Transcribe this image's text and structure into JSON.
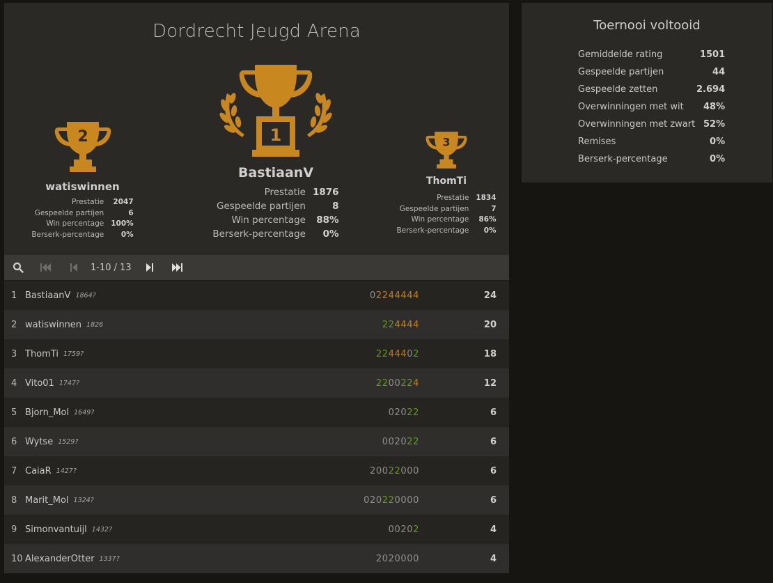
{
  "tournament": {
    "title": "Dordrecht Jeugd Arena"
  },
  "podium": {
    "first": {
      "rank": "1",
      "name": "BastiaanV",
      "stats": [
        {
          "label": "Prestatie",
          "value": "1876"
        },
        {
          "label": "Gespeelde partijen",
          "value": "8"
        },
        {
          "label": "Win percentage",
          "value": "88%"
        },
        {
          "label": "Berserk-percentage",
          "value": "0%"
        }
      ]
    },
    "second": {
      "rank": "2",
      "name": "watiswinnen",
      "stats": [
        {
          "label": "Prestatie",
          "value": "2047"
        },
        {
          "label": "Gespeelde partijen",
          "value": "6"
        },
        {
          "label": "Win percentage",
          "value": "100%"
        },
        {
          "label": "Berserk-percentage",
          "value": "0%"
        }
      ]
    },
    "third": {
      "rank": "3",
      "name": "ThomTi",
      "stats": [
        {
          "label": "Prestatie",
          "value": "1834"
        },
        {
          "label": "Gespeelde partijen",
          "value": "7"
        },
        {
          "label": "Win percentage",
          "value": "86%"
        },
        {
          "label": "Berserk-percentage",
          "value": "0%"
        }
      ]
    }
  },
  "pager": {
    "range": "1-10 / 13",
    "icons": [
      "search-icon",
      "first-page-icon",
      "prev-page-icon",
      "next-page-icon",
      "last-page-icon"
    ]
  },
  "standings": [
    {
      "rank": "1",
      "name": "BastiaanV",
      "rating": "1864?",
      "sheet": [
        [
          "n",
          "0"
        ],
        [
          "o",
          "2244444"
        ]
      ],
      "score": "24"
    },
    {
      "rank": "2",
      "name": "watiswinnen",
      "rating": "1826",
      "sheet": [
        [
          "g",
          "22"
        ],
        [
          "o",
          "4444"
        ]
      ],
      "score": "20"
    },
    {
      "rank": "3",
      "name": "ThomTi",
      "rating": "1759?",
      "sheet": [
        [
          "g",
          "22"
        ],
        [
          "o",
          "444"
        ],
        [
          "n",
          "0"
        ],
        [
          "g",
          "2"
        ]
      ],
      "score": "18"
    },
    {
      "rank": "4",
      "name": "Vito01",
      "rating": "1747?",
      "sheet": [
        [
          "g",
          "22"
        ],
        [
          "n",
          "00"
        ],
        [
          "g",
          "22"
        ],
        [
          "o",
          "4"
        ]
      ],
      "score": "12"
    },
    {
      "rank": "5",
      "name": "Bjorn_Mol",
      "rating": "1649?",
      "sheet": [
        [
          "n",
          "020"
        ],
        [
          "g",
          "22"
        ]
      ],
      "score": "6"
    },
    {
      "rank": "6",
      "name": "Wytse",
      "rating": "1529?",
      "sheet": [
        [
          "n",
          "0020"
        ],
        [
          "g",
          "22"
        ]
      ],
      "score": "6"
    },
    {
      "rank": "7",
      "name": "CaiaR",
      "rating": "1427?",
      "sheet": [
        [
          "n",
          "200"
        ],
        [
          "g",
          "22"
        ],
        [
          "n",
          "000"
        ]
      ],
      "score": "6"
    },
    {
      "rank": "8",
      "name": "Marit_Mol",
      "rating": "1324?",
      "sheet": [
        [
          "n",
          "020"
        ],
        [
          "g",
          "22"
        ],
        [
          "n",
          "0000"
        ]
      ],
      "score": "6"
    },
    {
      "rank": "9",
      "name": "Simonvantuijl",
      "rating": "1432?",
      "sheet": [
        [
          "n",
          "0020"
        ],
        [
          "g",
          "2"
        ]
      ],
      "score": "4"
    },
    {
      "rank": "10",
      "name": "AlexanderOtter",
      "rating": "1337?",
      "sheet": [
        [
          "n",
          "2020000"
        ]
      ],
      "score": "4"
    }
  ],
  "summary": {
    "title": "Toernooi voltooid",
    "rows": [
      {
        "label": "Gemiddelde rating",
        "value": "1501"
      },
      {
        "label": "Gespeelde partijen",
        "value": "44"
      },
      {
        "label": "Gespeelde zetten",
        "value": "2.694"
      },
      {
        "label": "Overwinningen met wit",
        "value": "48%"
      },
      {
        "label": "Overwinningen met zwart",
        "value": "52%"
      },
      {
        "label": "Remises",
        "value": "0%"
      },
      {
        "label": "Berserk-percentage",
        "value": "0%"
      }
    ]
  },
  "colors": {
    "accent_gold": "#c98720",
    "win_green": "#629924",
    "streak_orange": "#bf811d",
    "neutral": "#8f8f8f"
  }
}
